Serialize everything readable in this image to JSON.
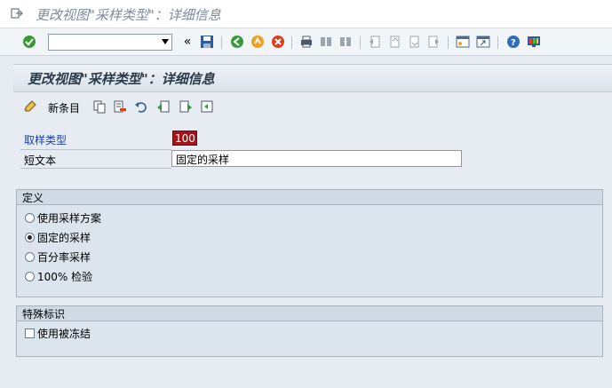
{
  "window": {
    "title": "更改视图\"采样类型\"：详细信息"
  },
  "toolbar": {
    "command_field_value": "",
    "icons": [
      "enter-icon",
      "back-arrows-icon",
      "save-icon",
      "back-icon",
      "exit-icon",
      "cancel-icon",
      "print-icon",
      "find-icon",
      "find-next-icon",
      "first-page-icon",
      "prev-page-icon",
      "next-page-icon",
      "last-page-icon",
      "new-session-icon",
      "shortcut-icon",
      "help-icon",
      "layout-icon"
    ]
  },
  "screen": {
    "title": "更改视图\"采样类型\"：详细信息",
    "app_toolbar": {
      "new_entries_label": "新条目"
    }
  },
  "form": {
    "sampling_type_label": "取样类型",
    "sampling_type_value": "100",
    "short_text_label": "短文本",
    "short_text_value": "固定的采样"
  },
  "definition": {
    "header": "定义",
    "options": [
      {
        "label": "使用采样方案",
        "selected": false
      },
      {
        "label": "固定的采样",
        "selected": true
      },
      {
        "label": "百分率采样",
        "selected": false
      },
      {
        "label": "100% 检验",
        "selected": false
      }
    ]
  },
  "special": {
    "header": "特殊标识",
    "checkbox_label": "使用被冻结",
    "checked": false
  },
  "colors": {
    "key_field_bg": "#a0151b",
    "link_label": "#1a3fb0",
    "title_text": "#7f8c9a"
  }
}
